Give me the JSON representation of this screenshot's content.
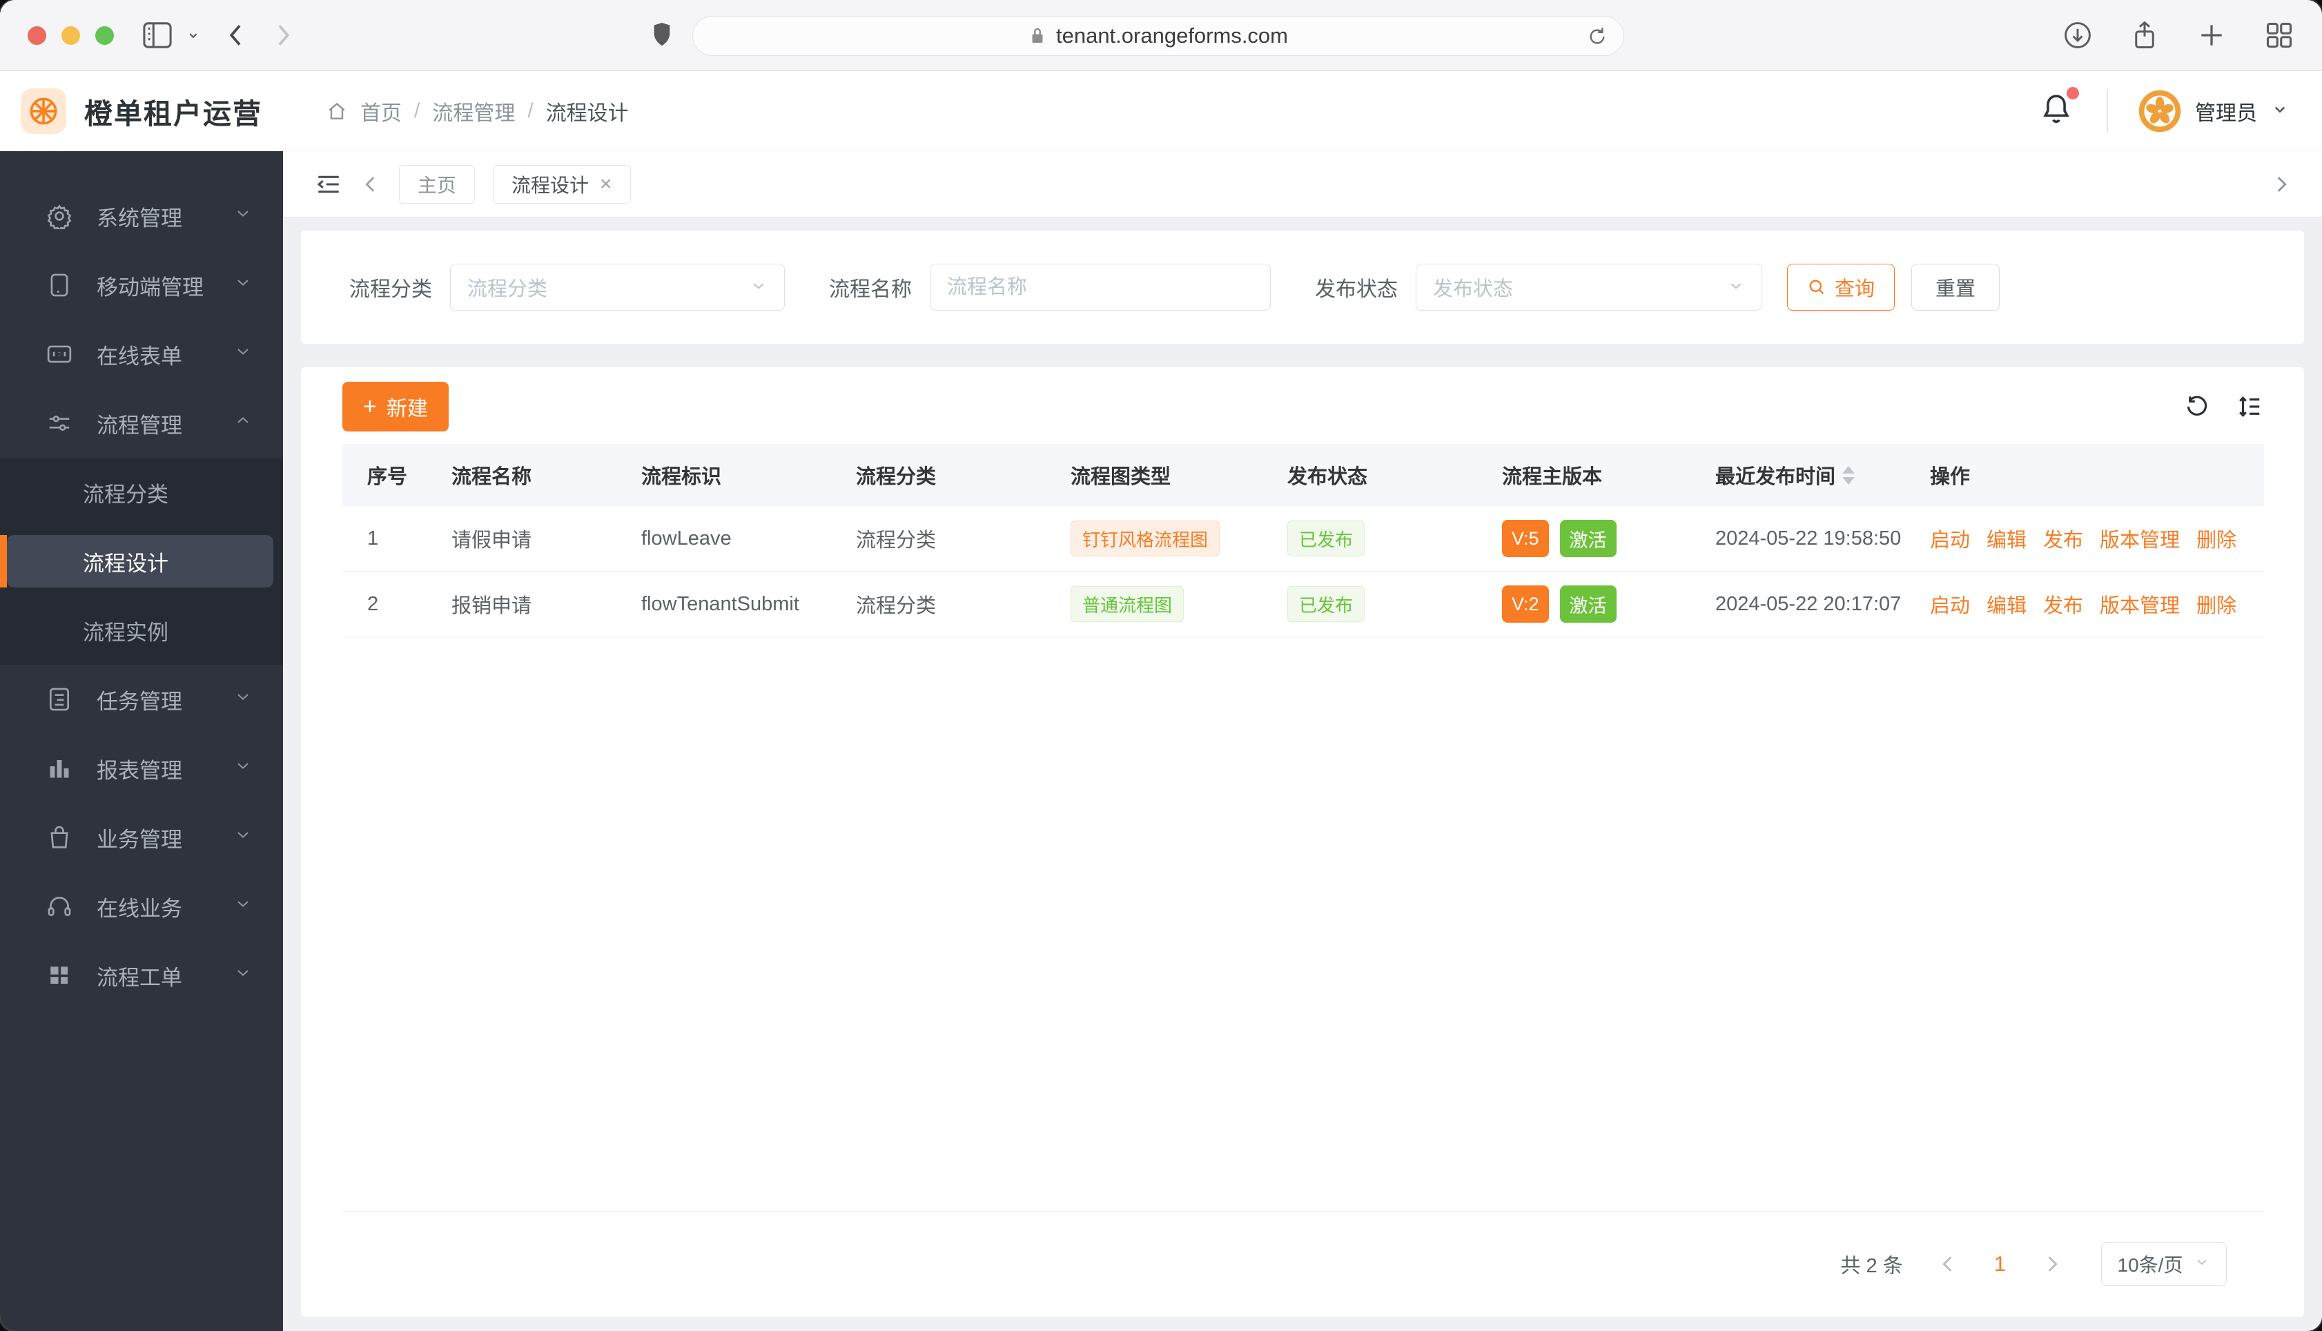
{
  "browser": {
    "url": "tenant.orangeforms.com"
  },
  "app_header": {
    "title": "橙单租户运营",
    "breadcrumb": {
      "home": "首页",
      "section": "流程管理",
      "current": "流程设计"
    },
    "user_name": "管理员"
  },
  "sidebar": {
    "items": [
      {
        "label": "系统管理"
      },
      {
        "label": "移动端管理"
      },
      {
        "label": "在线表单"
      },
      {
        "label": "流程管理",
        "children": [
          "流程分类",
          "流程设计",
          "流程实例"
        ],
        "active_child": "流程设计"
      },
      {
        "label": "任务管理"
      },
      {
        "label": "报表管理"
      },
      {
        "label": "业务管理"
      },
      {
        "label": "在线业务"
      },
      {
        "label": "流程工单"
      }
    ]
  },
  "tabbar": {
    "tabs": [
      {
        "label": "主页"
      },
      {
        "label": "流程设计"
      }
    ]
  },
  "filters": {
    "category": {
      "label": "流程分类",
      "placeholder": "流程分类"
    },
    "name": {
      "label": "流程名称",
      "placeholder": "流程名称"
    },
    "status": {
      "label": "发布状态",
      "placeholder": "发布状态"
    },
    "search_label": "查询",
    "reset_label": "重置"
  },
  "toolbar": {
    "create_label": "新建"
  },
  "table": {
    "headers": [
      "序号",
      "流程名称",
      "流程标识",
      "流程分类",
      "流程图类型",
      "发布状态",
      "流程主版本",
      "最近发布时间",
      "操作"
    ],
    "actions": [
      "启动",
      "编辑",
      "发布",
      "版本管理",
      "删除"
    ],
    "rows": [
      {
        "index": "1",
        "name": "请假申请",
        "key": "flowLeave",
        "category": "流程分类",
        "diagram_type": "钉钉风格流程图",
        "status": "已发布",
        "version": "V:5",
        "active": "激活",
        "published_at": "2024-05-22 19:58:50"
      },
      {
        "index": "2",
        "name": "报销申请",
        "key": "flowTenantSubmit",
        "category": "流程分类",
        "diagram_type": "普通流程图",
        "status": "已发布",
        "version": "V:2",
        "active": "激活",
        "published_at": "2024-05-22 20:17:07"
      }
    ]
  },
  "pagination": {
    "total": "共 2 条",
    "page": "1",
    "page_size": "10条/页"
  },
  "icons": {
    "plus": "+",
    "close": "×",
    "slash": "/"
  },
  "colors": {
    "accent": "#f87c23",
    "green": "#6dc23c",
    "accent_light_bg": "#fdefe4",
    "green_light_bg": "#f0f9eb",
    "sidebar_bg": "#2e333d"
  }
}
